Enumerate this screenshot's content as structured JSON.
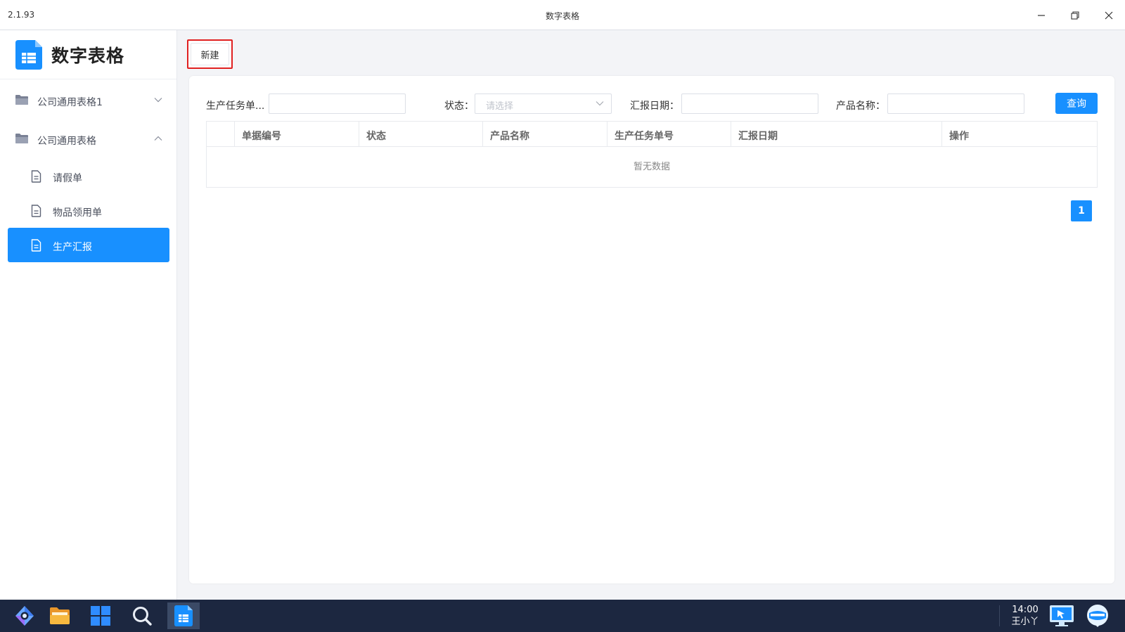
{
  "window": {
    "version": "2.1.93",
    "title": "数字表格"
  },
  "sidebar": {
    "brand": "数字表格",
    "groups": [
      {
        "label": "公司通用表格1",
        "expanded": false
      },
      {
        "label": "公司通用表格",
        "expanded": true
      }
    ],
    "items": [
      {
        "label": "请假单",
        "active": false
      },
      {
        "label": "物品领用单",
        "active": false
      },
      {
        "label": "生产汇报",
        "active": true
      }
    ]
  },
  "toolbar": {
    "new_label": "新建"
  },
  "filters": {
    "task_no_label": "生产任务单...",
    "task_no_value": "",
    "status_label": "状态：",
    "status_placeholder": "请选择",
    "report_date_label": "汇报日期：",
    "report_date_value": "",
    "product_name_label": "产品名称：",
    "product_name_value": "",
    "query_label": "查询"
  },
  "table": {
    "columns": [
      "单据编号",
      "状态",
      "产品名称",
      "生产任务单号",
      "汇报日期",
      "操作"
    ],
    "rows": [],
    "empty_text": "暂无数据"
  },
  "pagination": {
    "current_page": "1"
  },
  "taskbar": {
    "time": "14:00",
    "user": "王小丫"
  },
  "colors": {
    "accent": "#1890ff",
    "highlight_border": "#e02020",
    "taskbar": "#1c2740"
  }
}
